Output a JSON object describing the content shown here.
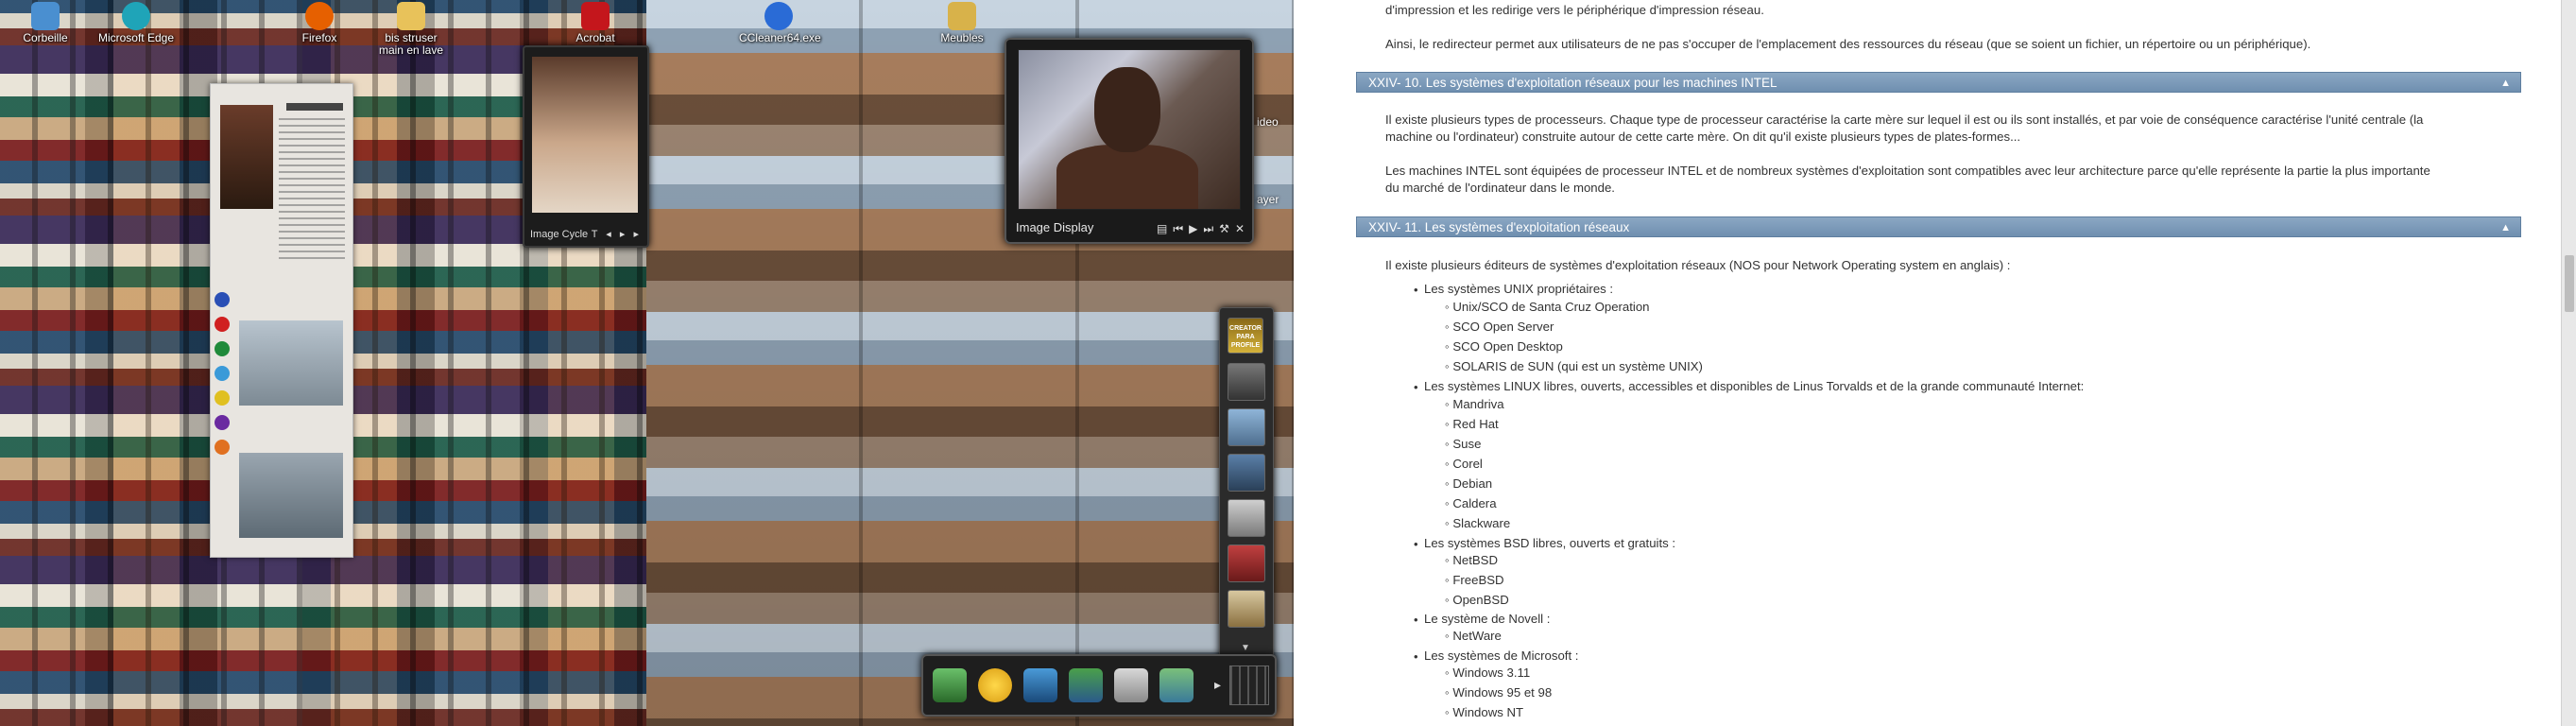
{
  "desktop": {
    "icons": [
      {
        "label": "Corbeille",
        "icon": "recycle-bin-icon",
        "color": "#4a8fd0"
      },
      {
        "label": "Microsoft Edge",
        "icon": "edge-icon",
        "color": "#1fa4b8"
      },
      {
        "label": "Firefox",
        "icon": "firefox-icon",
        "color": "#e66000"
      },
      {
        "label": "bis struser main en lave",
        "icon": "folder-icon",
        "color": "#e8c25a"
      },
      {
        "label": "Acrobat Reader DC",
        "icon": "acrobat-icon",
        "color": "#c4161c"
      },
      {
        "label": "CCleaner64.exe",
        "icon": "ccleaner-icon",
        "color": "#2a6bd6"
      },
      {
        "label": "Meubles",
        "icon": "folder-icon",
        "color": "#d8b24a"
      }
    ],
    "image_display": {
      "title": "Image Display"
    },
    "small_gadget": {
      "caption": "Image Cycle",
      "controls": "T ◂ ▸ ▸"
    },
    "sidebar_dock": {
      "creator_label": "CREATOR PARA PROFILE"
    },
    "side_labels": [
      "ideo",
      "ayer"
    ]
  },
  "doc": {
    "intro": [
      "d'impression et les redirige vers le périphérique d'impression réseau.",
      "Ainsi, le redirecteur permet aux utilisateurs de ne pas s'occuper de l'emplacement des ressources du réseau (que se soient un fichier, un répertoire ou un périphérique)."
    ],
    "section10": {
      "title": "XXIV- 10. Les systèmes d'exploitation réseaux pour les machines INTEL",
      "toggle": "▲",
      "paragraphs": [
        "Il existe plusieurs types de processeurs. Chaque type de processeur caractérise la carte mère sur lequel il est ou ils sont installés, et par voie de conséquence caractérise l'unité centrale (la",
        "machine ou l'ordinateur) construite autour de cette carte mère. On dit qu'il existe plusieurs types de plates-formes...",
        "Les machines INTEL sont équipées de processeur INTEL et de nombreux systèmes d'exploitation sont compatibles avec leur architecture parce qu'elle représente la partie la plus importante",
        "du marché de l'ordinateur dans le monde."
      ]
    },
    "section11": {
      "title": "XXIV- 11. Les systèmes d'exploitation réseaux",
      "toggle": "▲",
      "intro": "Il existe plusieurs éditeurs de systèmes d'exploitation réseaux (NOS pour Network Operating system en anglais) :",
      "groups": [
        {
          "label": "Les systèmes UNIX propriétaires :",
          "items": [
            "Unix/SCO de Santa Cruz Operation",
            "SCO Open Server",
            "SCO Open Desktop",
            "SOLARIS de SUN (qui est un système UNIX)"
          ]
        },
        {
          "label": "Les systèmes LINUX libres, ouverts, accessibles et disponibles de Linus Torvalds et de la grande communauté Internet:",
          "items": [
            "Mandriva",
            "Red Hat",
            "Suse",
            "Corel",
            "Debian",
            "Caldera",
            "Slackware"
          ]
        },
        {
          "label": "Les systèmes BSD libres, ouverts et gratuits :",
          "items": [
            "NetBSD",
            "FreeBSD",
            "OpenBSD"
          ]
        },
        {
          "label": "Le système de Novell :",
          "items": [
            "NetWare"
          ]
        },
        {
          "label": "Les systèmes de Microsoft :",
          "items": [
            "Windows 3.11",
            "Windows 95 et 98",
            "Windows NT"
          ]
        }
      ]
    }
  }
}
